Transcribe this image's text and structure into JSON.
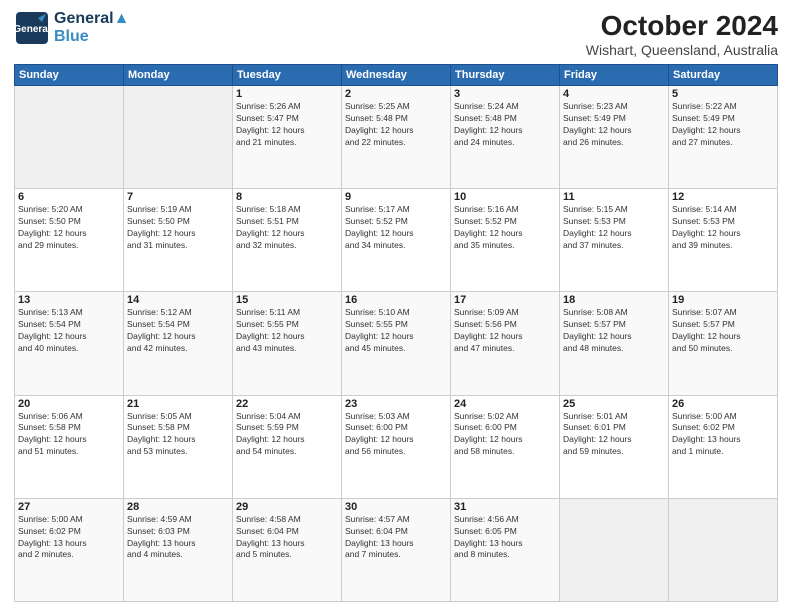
{
  "header": {
    "logo_line1": "General",
    "logo_line2": "Blue",
    "title": "October 2024",
    "subtitle": "Wishart, Queensland, Australia"
  },
  "weekdays": [
    "Sunday",
    "Monday",
    "Tuesday",
    "Wednesday",
    "Thursday",
    "Friday",
    "Saturday"
  ],
  "weeks": [
    [
      {
        "day": "",
        "info": ""
      },
      {
        "day": "",
        "info": ""
      },
      {
        "day": "1",
        "info": "Sunrise: 5:26 AM\nSunset: 5:47 PM\nDaylight: 12 hours\nand 21 minutes."
      },
      {
        "day": "2",
        "info": "Sunrise: 5:25 AM\nSunset: 5:48 PM\nDaylight: 12 hours\nand 22 minutes."
      },
      {
        "day": "3",
        "info": "Sunrise: 5:24 AM\nSunset: 5:48 PM\nDaylight: 12 hours\nand 24 minutes."
      },
      {
        "day": "4",
        "info": "Sunrise: 5:23 AM\nSunset: 5:49 PM\nDaylight: 12 hours\nand 26 minutes."
      },
      {
        "day": "5",
        "info": "Sunrise: 5:22 AM\nSunset: 5:49 PM\nDaylight: 12 hours\nand 27 minutes."
      }
    ],
    [
      {
        "day": "6",
        "info": "Sunrise: 5:20 AM\nSunset: 5:50 PM\nDaylight: 12 hours\nand 29 minutes."
      },
      {
        "day": "7",
        "info": "Sunrise: 5:19 AM\nSunset: 5:50 PM\nDaylight: 12 hours\nand 31 minutes."
      },
      {
        "day": "8",
        "info": "Sunrise: 5:18 AM\nSunset: 5:51 PM\nDaylight: 12 hours\nand 32 minutes."
      },
      {
        "day": "9",
        "info": "Sunrise: 5:17 AM\nSunset: 5:52 PM\nDaylight: 12 hours\nand 34 minutes."
      },
      {
        "day": "10",
        "info": "Sunrise: 5:16 AM\nSunset: 5:52 PM\nDaylight: 12 hours\nand 35 minutes."
      },
      {
        "day": "11",
        "info": "Sunrise: 5:15 AM\nSunset: 5:53 PM\nDaylight: 12 hours\nand 37 minutes."
      },
      {
        "day": "12",
        "info": "Sunrise: 5:14 AM\nSunset: 5:53 PM\nDaylight: 12 hours\nand 39 minutes."
      }
    ],
    [
      {
        "day": "13",
        "info": "Sunrise: 5:13 AM\nSunset: 5:54 PM\nDaylight: 12 hours\nand 40 minutes."
      },
      {
        "day": "14",
        "info": "Sunrise: 5:12 AM\nSunset: 5:54 PM\nDaylight: 12 hours\nand 42 minutes."
      },
      {
        "day": "15",
        "info": "Sunrise: 5:11 AM\nSunset: 5:55 PM\nDaylight: 12 hours\nand 43 minutes."
      },
      {
        "day": "16",
        "info": "Sunrise: 5:10 AM\nSunset: 5:55 PM\nDaylight: 12 hours\nand 45 minutes."
      },
      {
        "day": "17",
        "info": "Sunrise: 5:09 AM\nSunset: 5:56 PM\nDaylight: 12 hours\nand 47 minutes."
      },
      {
        "day": "18",
        "info": "Sunrise: 5:08 AM\nSunset: 5:57 PM\nDaylight: 12 hours\nand 48 minutes."
      },
      {
        "day": "19",
        "info": "Sunrise: 5:07 AM\nSunset: 5:57 PM\nDaylight: 12 hours\nand 50 minutes."
      }
    ],
    [
      {
        "day": "20",
        "info": "Sunrise: 5:06 AM\nSunset: 5:58 PM\nDaylight: 12 hours\nand 51 minutes."
      },
      {
        "day": "21",
        "info": "Sunrise: 5:05 AM\nSunset: 5:58 PM\nDaylight: 12 hours\nand 53 minutes."
      },
      {
        "day": "22",
        "info": "Sunrise: 5:04 AM\nSunset: 5:59 PM\nDaylight: 12 hours\nand 54 minutes."
      },
      {
        "day": "23",
        "info": "Sunrise: 5:03 AM\nSunset: 6:00 PM\nDaylight: 12 hours\nand 56 minutes."
      },
      {
        "day": "24",
        "info": "Sunrise: 5:02 AM\nSunset: 6:00 PM\nDaylight: 12 hours\nand 58 minutes."
      },
      {
        "day": "25",
        "info": "Sunrise: 5:01 AM\nSunset: 6:01 PM\nDaylight: 12 hours\nand 59 minutes."
      },
      {
        "day": "26",
        "info": "Sunrise: 5:00 AM\nSunset: 6:02 PM\nDaylight: 13 hours\nand 1 minute."
      }
    ],
    [
      {
        "day": "27",
        "info": "Sunrise: 5:00 AM\nSunset: 6:02 PM\nDaylight: 13 hours\nand 2 minutes."
      },
      {
        "day": "28",
        "info": "Sunrise: 4:59 AM\nSunset: 6:03 PM\nDaylight: 13 hours\nand 4 minutes."
      },
      {
        "day": "29",
        "info": "Sunrise: 4:58 AM\nSunset: 6:04 PM\nDaylight: 13 hours\nand 5 minutes."
      },
      {
        "day": "30",
        "info": "Sunrise: 4:57 AM\nSunset: 6:04 PM\nDaylight: 13 hours\nand 7 minutes."
      },
      {
        "day": "31",
        "info": "Sunrise: 4:56 AM\nSunset: 6:05 PM\nDaylight: 13 hours\nand 8 minutes."
      },
      {
        "day": "",
        "info": ""
      },
      {
        "day": "",
        "info": ""
      }
    ]
  ]
}
